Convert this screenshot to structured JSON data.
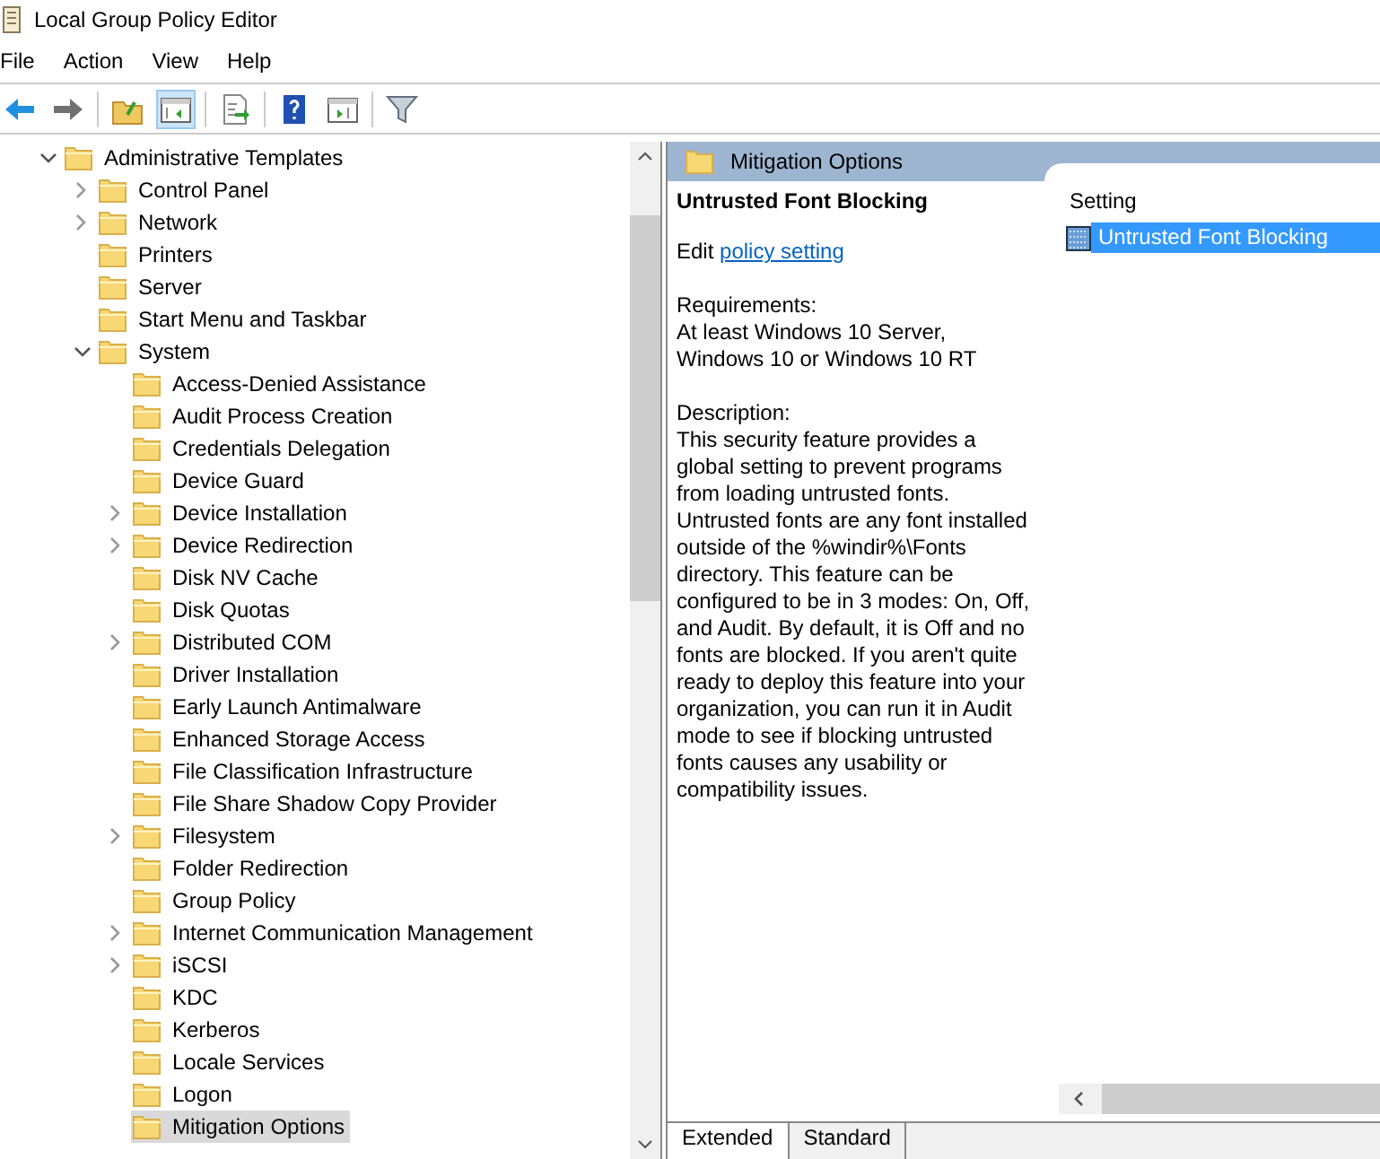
{
  "window": {
    "title": "Local Group Policy Editor"
  },
  "menu": [
    "File",
    "Action",
    "View",
    "Help"
  ],
  "toolbar": [
    {
      "kind": "back",
      "pressed": false
    },
    {
      "kind": "forward",
      "pressed": false
    },
    {
      "kind": "up",
      "pressed": false
    },
    {
      "kind": "tree",
      "pressed": true
    },
    {
      "kind": "export",
      "pressed": false
    },
    {
      "kind": "help",
      "pressed": false
    },
    {
      "kind": "pane",
      "pressed": false
    },
    {
      "kind": "filter",
      "pressed": false
    }
  ],
  "tree": [
    {
      "label": "Administrative Templates",
      "expanded": true,
      "selected": false,
      "children": [
        {
          "label": "Control Panel",
          "expanded": false,
          "selected": false
        },
        {
          "label": "Network",
          "expanded": false,
          "selected": false
        },
        {
          "label": "Printers",
          "selected": false
        },
        {
          "label": "Server",
          "selected": false
        },
        {
          "label": "Start Menu and Taskbar",
          "selected": false
        },
        {
          "label": "System",
          "expanded": true,
          "selected": false,
          "children": [
            {
              "label": "Access-Denied Assistance",
              "selected": false
            },
            {
              "label": "Audit Process Creation",
              "selected": false
            },
            {
              "label": "Credentials Delegation",
              "selected": false
            },
            {
              "label": "Device Guard",
              "selected": false
            },
            {
              "label": "Device Installation",
              "expanded": false,
              "selected": false
            },
            {
              "label": "Device Redirection",
              "expanded": false,
              "selected": false
            },
            {
              "label": "Disk NV Cache",
              "selected": false
            },
            {
              "label": "Disk Quotas",
              "selected": false
            },
            {
              "label": "Distributed COM",
              "expanded": false,
              "selected": false
            },
            {
              "label": "Driver Installation",
              "selected": false
            },
            {
              "label": "Early Launch Antimalware",
              "selected": false
            },
            {
              "label": "Enhanced Storage Access",
              "selected": false
            },
            {
              "label": "File Classification Infrastructure",
              "selected": false
            },
            {
              "label": "File Share Shadow Copy Provider",
              "selected": false
            },
            {
              "label": "Filesystem",
              "expanded": false,
              "selected": false
            },
            {
              "label": "Folder Redirection",
              "selected": false
            },
            {
              "label": "Group Policy",
              "selected": false
            },
            {
              "label": "Internet Communication Management",
              "expanded": false,
              "selected": false
            },
            {
              "label": "iSCSI",
              "expanded": false,
              "selected": false
            },
            {
              "label": "KDC",
              "selected": false
            },
            {
              "label": "Kerberos",
              "selected": false
            },
            {
              "label": "Locale Services",
              "selected": false
            },
            {
              "label": "Logon",
              "selected": false
            },
            {
              "label": "Mitigation Options",
              "selected": true
            }
          ]
        }
      ]
    }
  ],
  "details": {
    "header": "Mitigation Options",
    "title": "Untrusted Font Blocking",
    "edit_prefix": "Edit",
    "edit_link": "policy setting",
    "requirements_label": "Requirements:",
    "requirements": "At least Windows 10 Server, Windows 10 or Windows 10 RT",
    "description_label": "Description:",
    "description": "This security feature provides a global setting to prevent programs from loading untrusted fonts. Untrusted fonts are any font installed outside of the %windir%\\Fonts directory. This feature can be configured to be in 3 modes: On, Off, and Audit. By default, it is Off and no fonts are blocked. If you aren't quite ready to deploy this feature into your organization, you can run it in Audit mode to see if blocking untrusted fonts causes any usability or compatibility issues."
  },
  "settings": {
    "column": "Setting",
    "rows": [
      {
        "label": "Untrusted Font Blocking",
        "selected": true
      }
    ]
  },
  "tabs": [
    {
      "label": "Extended",
      "selected": true
    },
    {
      "label": "Standard",
      "selected": false
    }
  ]
}
